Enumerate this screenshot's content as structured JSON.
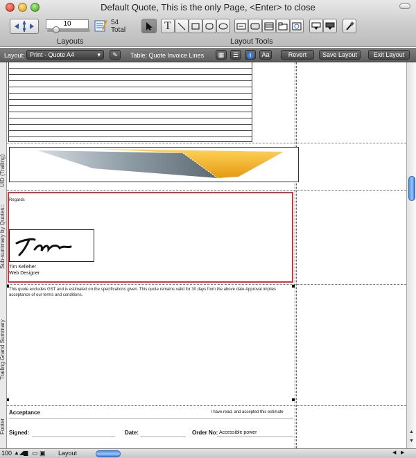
{
  "window": {
    "title": "Default Quote, This is the only Page, <Enter> to close"
  },
  "toolbar": {
    "record_number": "10",
    "total_count": "54",
    "total_label": "Total",
    "layouts_label": "Layouts",
    "layout_tools_label": "Layout Tools",
    "text_tool_glyph": "T"
  },
  "layout_bar": {
    "layout_label": "Layout:",
    "layout_value": "Print - Quote A4",
    "table_label": "Table: Quote Invoice Lines",
    "aa_label": "Aa",
    "revert_label": "Revert",
    "save_label": "Save Layout",
    "exit_label": "Exit Layout"
  },
  "parts": {
    "uid_trailing": "UID (Trailing)",
    "subsummary": "Sub-summary by Quotes::",
    "trailing_grand_summary": "Trailing Grand Summary",
    "footer": "Footer"
  },
  "signature_block": {
    "regards": "Regards",
    "name": "Tim Kelleher",
    "role": "Web Designer"
  },
  "disclaimer": "This quote excludes GST and is estimated on the specifications given. This quote remains valid for 30 days from the above date.Approval implies acceptance of our terms and conditions.",
  "footer": {
    "acceptance": "Acceptance",
    "accepted_text": "I have read, and accepted this estimate",
    "signed": "Signed:",
    "date": "Date:",
    "order_no": "Order No:",
    "accessible_power": "Accessible power"
  },
  "status_bar": {
    "zoom": "100",
    "mode": "Layout"
  },
  "colors": {
    "selection_red": "#d8343f",
    "banner_gold": "#f2b01e",
    "banner_steel": "#7e8c96",
    "scroll_blue": "#4d8fe6"
  }
}
